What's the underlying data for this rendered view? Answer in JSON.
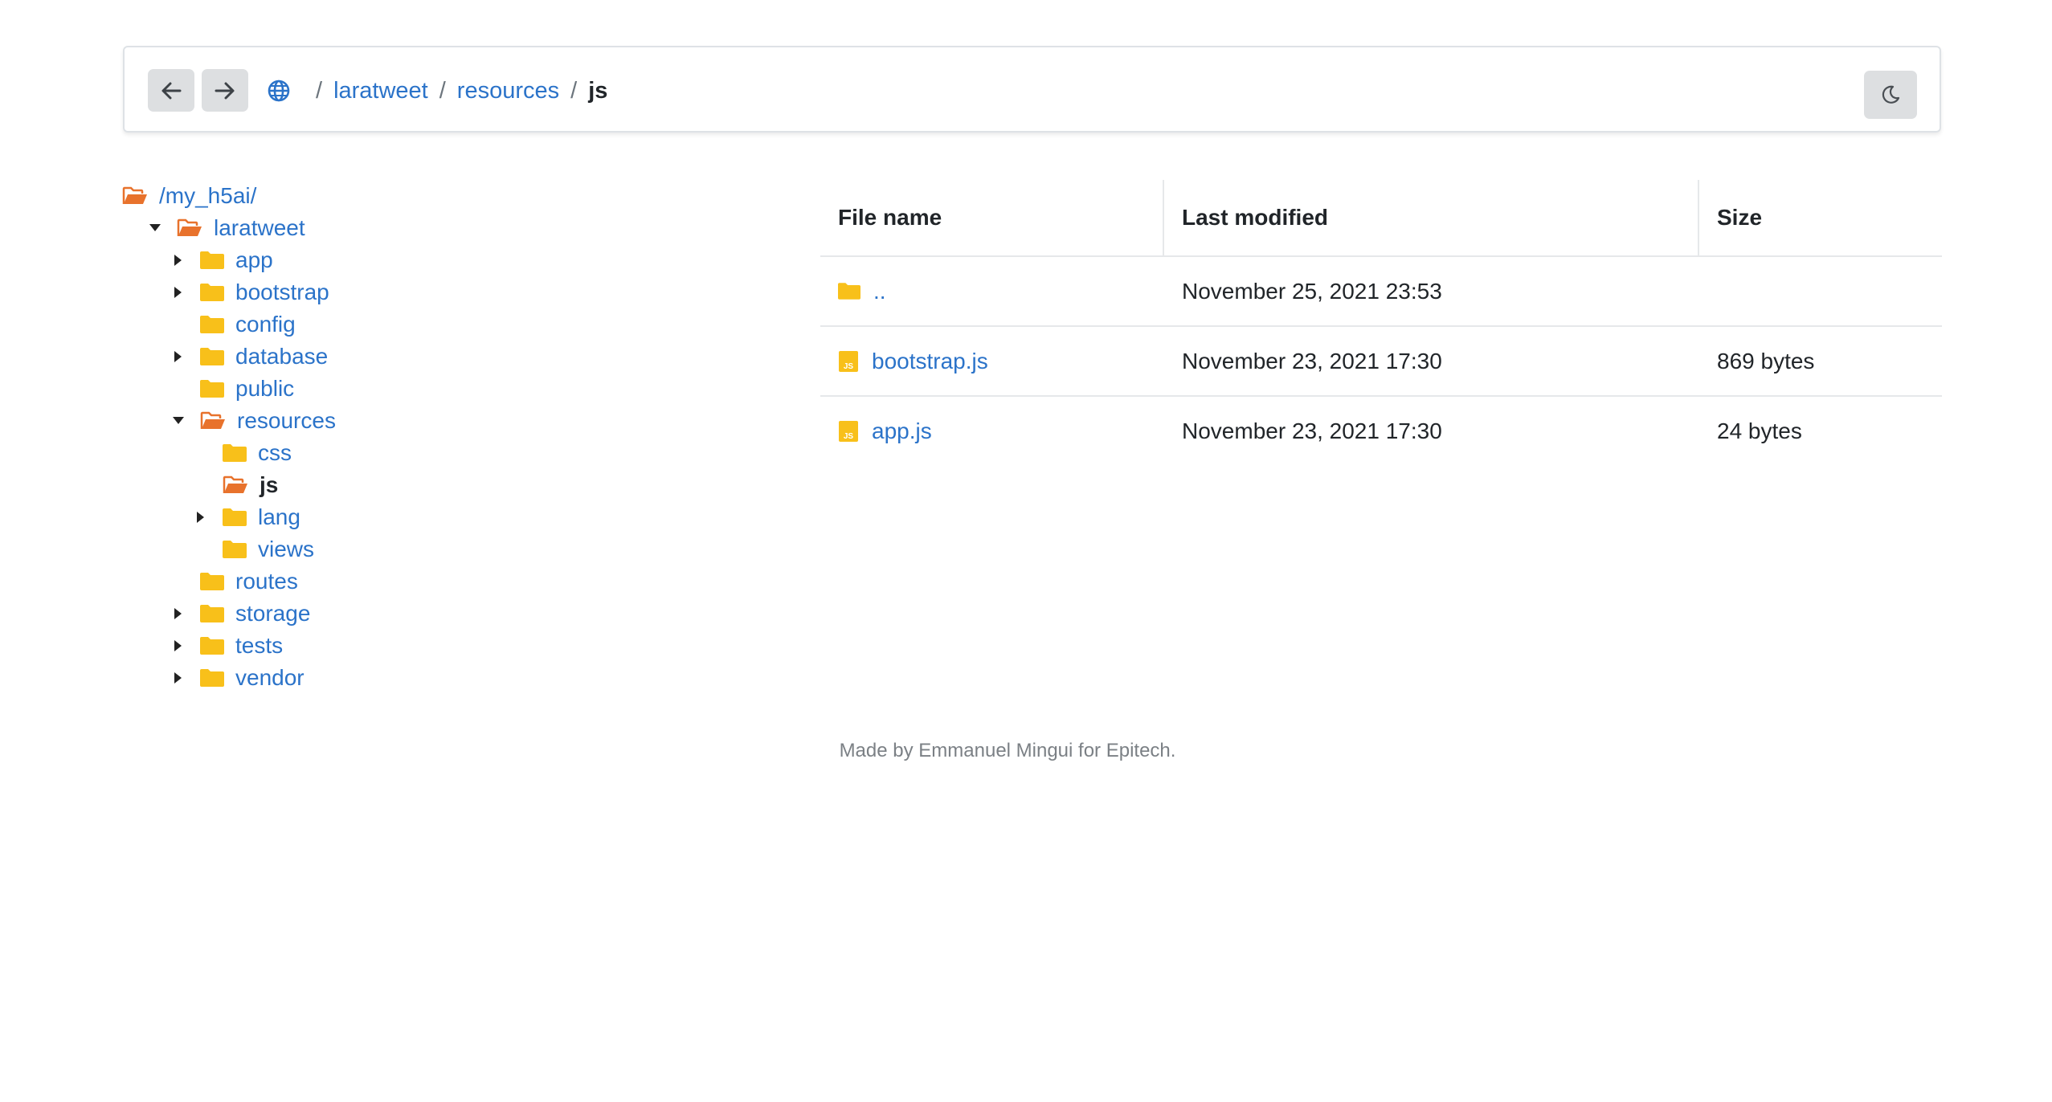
{
  "navbar": {
    "back_icon": "arrow-left-icon",
    "forward_icon": "arrow-right-icon",
    "home_icon": "globe-icon",
    "theme_icon": "moon-icon",
    "breadcrumb": [
      "laratweet",
      "resources",
      "js"
    ],
    "separator": "/"
  },
  "tree": {
    "root": "/my_h5ai/",
    "items": [
      {
        "label": "laratweet",
        "state": "open"
      },
      {
        "label": "app",
        "state": "collapsed"
      },
      {
        "label": "bootstrap",
        "state": "collapsed"
      },
      {
        "label": "config",
        "state": "leaf"
      },
      {
        "label": "database",
        "state": "collapsed"
      },
      {
        "label": "public",
        "state": "leaf"
      },
      {
        "label": "resources",
        "state": "open"
      },
      {
        "label": "css",
        "state": "leaf"
      },
      {
        "label": "js",
        "state": "current"
      },
      {
        "label": "lang",
        "state": "collapsed"
      },
      {
        "label": "views",
        "state": "leaf"
      },
      {
        "label": "routes",
        "state": "leaf"
      },
      {
        "label": "storage",
        "state": "collapsed"
      },
      {
        "label": "tests",
        "state": "collapsed"
      },
      {
        "label": "vendor",
        "state": "collapsed"
      }
    ]
  },
  "table": {
    "columns": [
      "File name",
      "Last modified",
      "Size"
    ],
    "rows": [
      {
        "name": "..",
        "modified": "November 25, 2021 23:53",
        "size": "",
        "icon": "folder-icon"
      },
      {
        "name": "bootstrap.js",
        "modified": "November 23, 2021 17:30",
        "size": "869 bytes",
        "icon": "js-file-icon"
      },
      {
        "name": "app.js",
        "modified": "November 23, 2021 17:30",
        "size": "24 bytes",
        "icon": "js-file-icon"
      }
    ]
  },
  "footer": {
    "text": "Made by Emmanuel Mingui for Epitech."
  },
  "colors": {
    "link": "#2b73c9",
    "folder": "#f8c01a",
    "open_folder": "#e8722c",
    "button_bg": "#dddfe1"
  }
}
